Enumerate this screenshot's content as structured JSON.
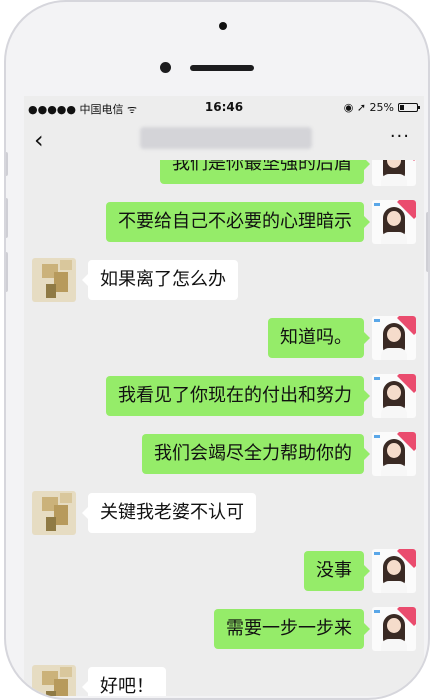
{
  "status_bar": {
    "signal": "●●●●● 中国电信 ᯤ",
    "time": "16:46",
    "right": "◉ ➚ 25%",
    "battery_level": 0.25
  },
  "nav": {
    "back_icon": "‹",
    "more_icon": "···"
  },
  "messages": [
    {
      "side": "me",
      "text": "我们是你最坚强的后盾"
    },
    {
      "side": "me",
      "text": "不要给自己不必要的心理暗示"
    },
    {
      "side": "them",
      "text": "如果离了怎么办"
    },
    {
      "side": "me",
      "text": "知道吗。"
    },
    {
      "side": "me",
      "text": "我看见了你现在的付出和努力"
    },
    {
      "side": "me",
      "text": "我们会竭尽全力帮助你的"
    },
    {
      "side": "them",
      "text": "关键我老婆不认可"
    },
    {
      "side": "me",
      "text": "没事"
    },
    {
      "side": "me",
      "text": "需要一步一步来"
    },
    {
      "side": "them",
      "text": "好吧！"
    }
  ],
  "colors": {
    "my_bubble": "#95ec69",
    "their_bubble": "#ffffff",
    "chat_background": "#ededed"
  }
}
